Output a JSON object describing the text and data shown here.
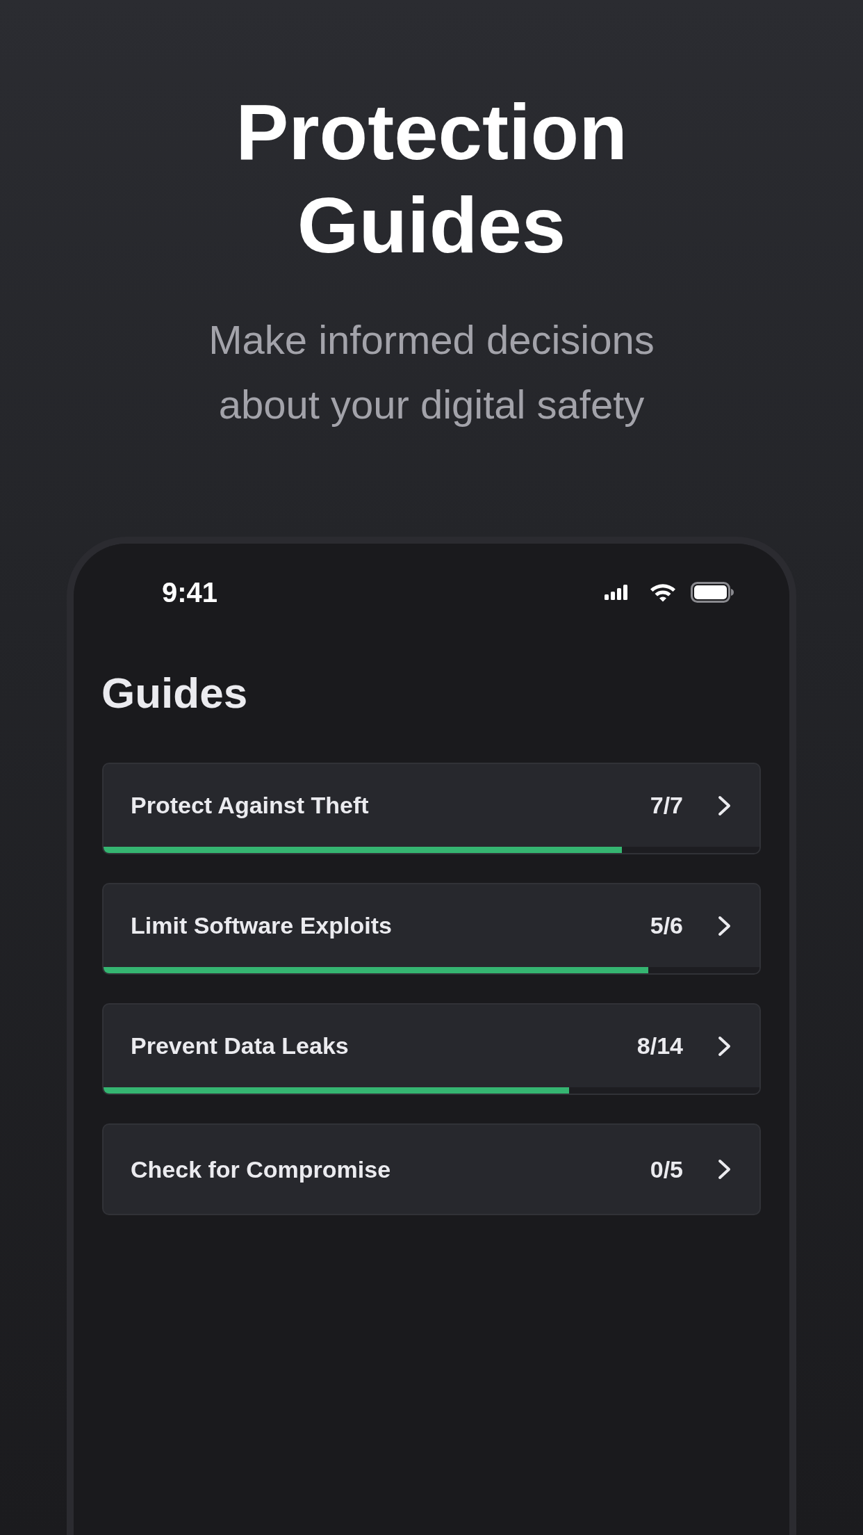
{
  "header": {
    "title": "Protection Guides",
    "subtitle": "Make informed decisions about your digital safety"
  },
  "phone": {
    "status_bar": {
      "time": "9:41"
    },
    "title": "Guides",
    "guides": [
      {
        "title": "Protect Against Theft",
        "count": "7/7",
        "level": 0.79
      },
      {
        "title": "Limit Software Exploits",
        "count": "5/6",
        "level": 0.83
      },
      {
        "title": "Prevent Data Leaks",
        "count": "8/14",
        "level": 0.71
      },
      {
        "title": "Check for Compromise",
        "count": "0/5"
      }
    ]
  }
}
